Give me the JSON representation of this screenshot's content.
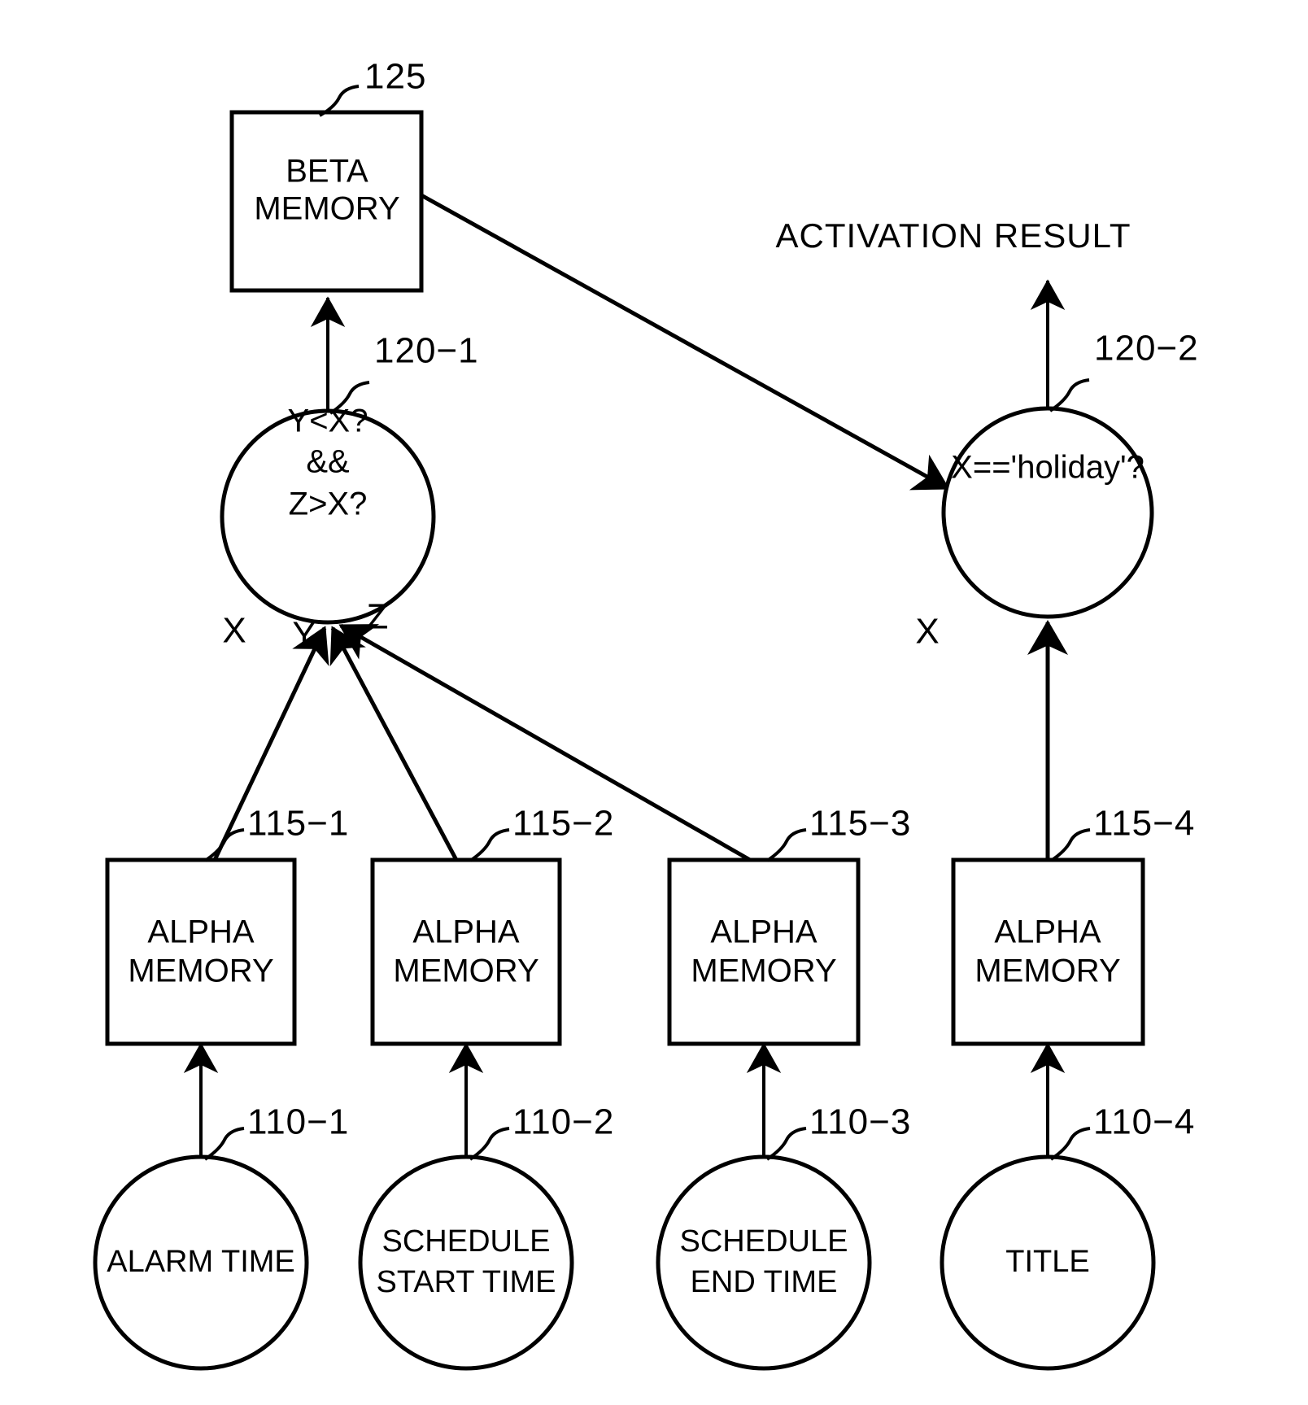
{
  "figure": {
    "type": "patent-diagram",
    "output_label": "ACTIVATION RESULT"
  },
  "beta_memory": {
    "line1": "BETA",
    "line2": "MEMORY",
    "ref": "125"
  },
  "join_nodes": [
    {
      "id": "120-1",
      "ref": "120−1",
      "line1": "Y<X?",
      "line2": "&&",
      "line3": "Z>X?"
    },
    {
      "id": "120-2",
      "ref": "120−2",
      "line1": "X=='holiday'?"
    }
  ],
  "alpha_memories": [
    {
      "ref": "115−1",
      "line1": "ALPHA",
      "line2": "MEMORY"
    },
    {
      "ref": "115−2",
      "line1": "ALPHA",
      "line2": "MEMORY"
    },
    {
      "ref": "115−3",
      "line1": "ALPHA",
      "line2": "MEMORY"
    },
    {
      "ref": "115−4",
      "line1": "ALPHA",
      "line2": "MEMORY"
    }
  ],
  "source_nodes": [
    {
      "ref": "110−1",
      "line1": "ALARM TIME",
      "line2": ""
    },
    {
      "ref": "110−2",
      "line1": "SCHEDULE",
      "line2": "START TIME"
    },
    {
      "ref": "110−3",
      "line1": "SCHEDULE",
      "line2": "END TIME"
    },
    {
      "ref": "110−4",
      "line1": "TITLE",
      "line2": ""
    }
  ],
  "variable_labels": [
    {
      "name": "x-left",
      "text": "X"
    },
    {
      "name": "y-left",
      "text": "Y"
    },
    {
      "name": "z-left",
      "text": "Z"
    },
    {
      "name": "x-right",
      "text": "X"
    }
  ],
  "colors": {
    "ink": "#000000",
    "paper": "#ffffff"
  }
}
